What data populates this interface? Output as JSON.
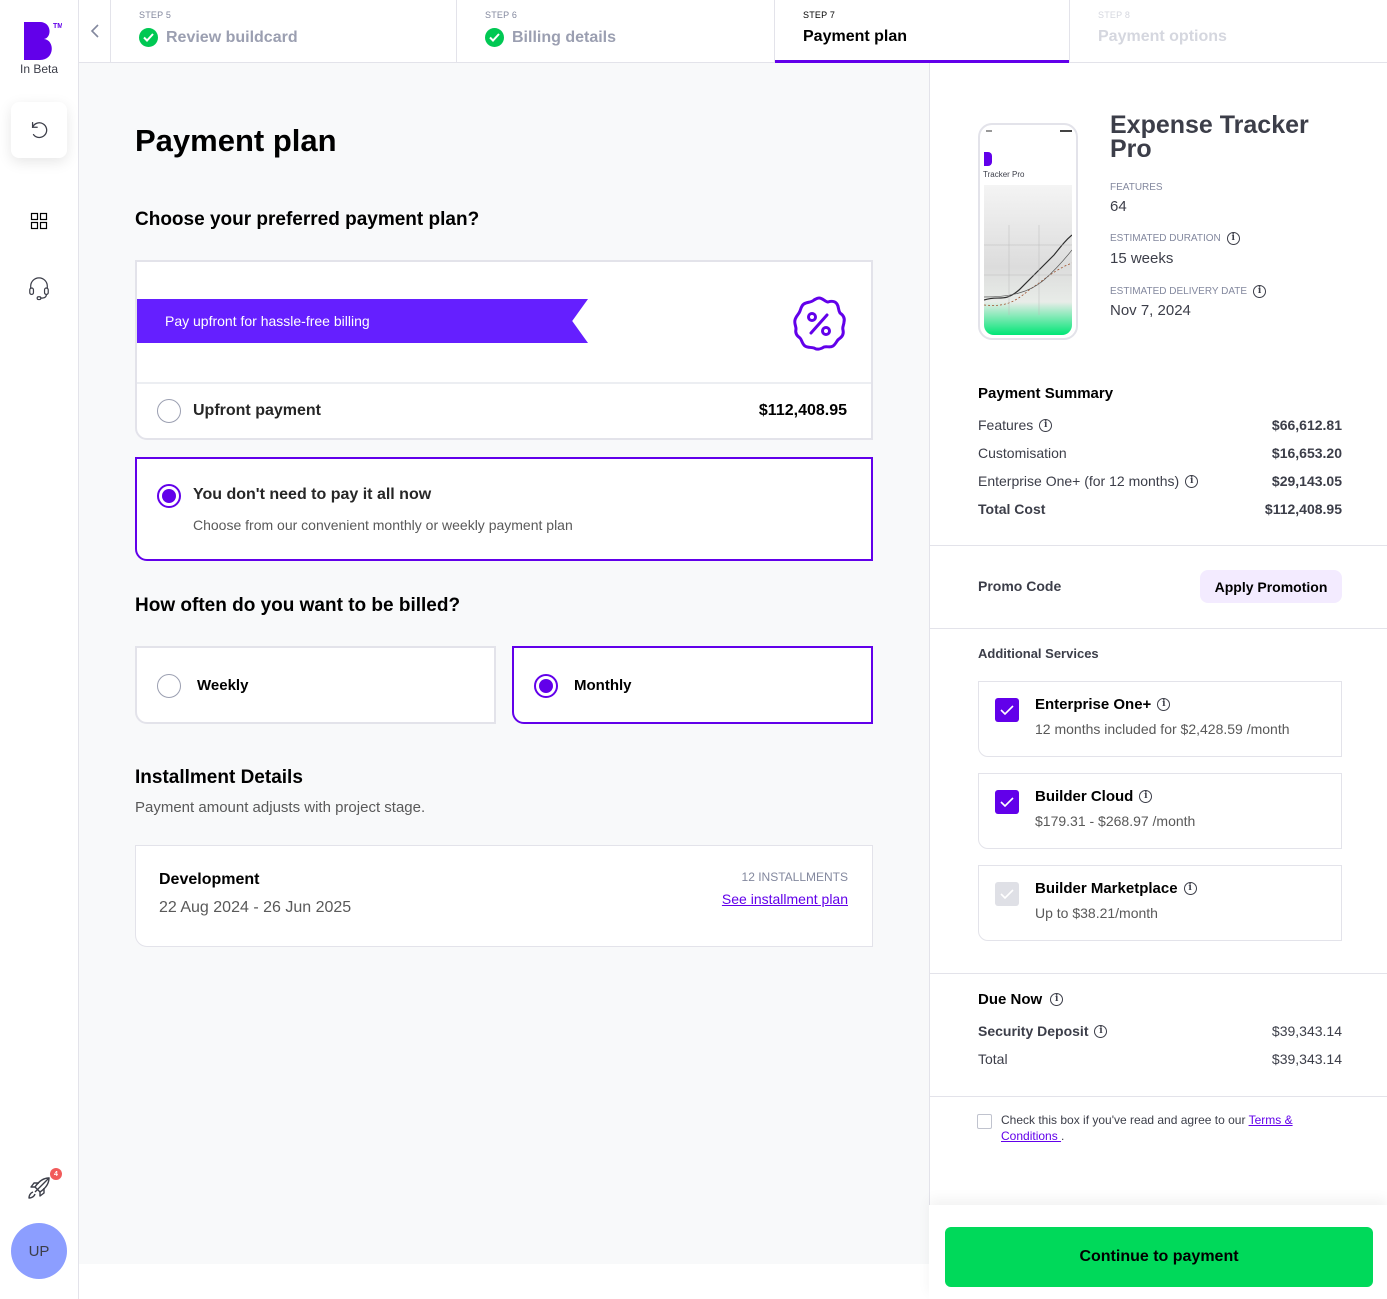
{
  "brand": {
    "beta_label": "In Beta",
    "trademark": "TM",
    "accent": "#6200ea",
    "ribbon_color": "#651fff",
    "success_color": "#00d95a"
  },
  "rail": {
    "notification_count": "4",
    "avatar_initials": "UP"
  },
  "steps": [
    {
      "number": "STEP 5",
      "label": "Review buildcard",
      "state": "completed"
    },
    {
      "number": "STEP 6",
      "label": "Billing details",
      "state": "completed"
    },
    {
      "number": "STEP 7",
      "label": "Payment plan",
      "state": "active"
    },
    {
      "number": "STEP 8",
      "label": "Payment options",
      "state": "disabled"
    }
  ],
  "main": {
    "title": "Payment plan",
    "plan_question": "Choose your preferred payment plan?",
    "upfront": {
      "ribbon": "Pay upfront for hassle-free billing",
      "label": "Upfront payment",
      "price": "$112,408.95",
      "selected": false
    },
    "installments": {
      "label": "You don't need to pay it all now",
      "description": "Choose from our convenient monthly or weekly payment plan",
      "selected": true
    },
    "billing_question": "How often do you want to be billed?",
    "frequency": [
      {
        "label": "Weekly",
        "selected": false
      },
      {
        "label": "Monthly",
        "selected": true
      }
    ],
    "installment_details": {
      "title": "Installment Details",
      "subtitle": "Payment amount adjusts with project stage.",
      "stage": "Development",
      "dates": "22 Aug 2024 - 26 Jun 2025",
      "count": "12 INSTALLMENTS",
      "link": "See installment plan"
    }
  },
  "summary": {
    "phone_title": "Tracker Pro",
    "product_name": "Expense Tracker Pro",
    "features_label": "FEATURES",
    "features_value": "64",
    "duration_label": "ESTIMATED DURATION",
    "duration_value": "15 weeks",
    "delivery_label": "ESTIMATED DELIVERY DATE",
    "delivery_value": "Nov 7, 2024",
    "payment_summary_title": "Payment Summary",
    "rows": [
      {
        "label": "Features",
        "value": "$66,612.81",
        "info": true
      },
      {
        "label": "Customisation",
        "value": "$16,653.20",
        "info": false
      },
      {
        "label": "Enterprise One+ (for 12 months)",
        "value": "$29,143.05",
        "info": true
      },
      {
        "label": "Total Cost",
        "value": "$112,408.95",
        "info": false
      }
    ],
    "promo_label": "Promo Code",
    "promo_button": "Apply Promotion",
    "additional_title": "Additional Services",
    "services": [
      {
        "name": "Enterprise One+",
        "desc": "12 months included for $2,428.59 /month",
        "checked": true
      },
      {
        "name": "Builder Cloud",
        "desc": "$179.31 - $268.97 /month",
        "checked": true
      },
      {
        "name": "Builder Marketplace",
        "desc": "Up to $38.21/month",
        "checked": false
      }
    ],
    "due_now_title": "Due Now",
    "security_deposit_label": "Security Deposit",
    "security_deposit_value": "$39,343.14",
    "total_label": "Total",
    "total_value": "$39,343.14",
    "terms_text": "Check this box if you've read and agree to our ",
    "terms_link": "Terms & Conditions ",
    "terms_end": ".",
    "cta": "Continue to payment"
  }
}
